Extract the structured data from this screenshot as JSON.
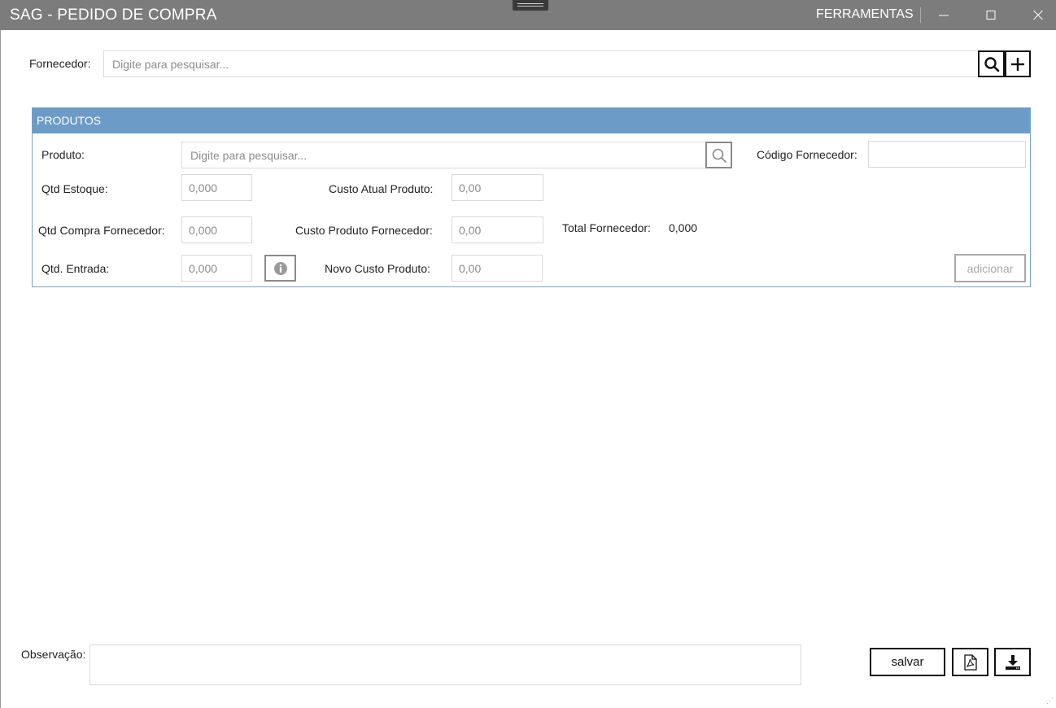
{
  "window": {
    "title": "SAG - PEDIDO DE COMPRA",
    "tools_menu": "FERRAMENTAS"
  },
  "fornecedor": {
    "label": "Fornecedor:",
    "placeholder": "Digite para pesquisar...",
    "search_icon": "search-icon",
    "add_icon": "plus-icon"
  },
  "produtos": {
    "header": "PRODUTOS",
    "produto_label": "Produto:",
    "produto_placeholder": "Digite para pesquisar...",
    "codigo_fornecedor_label": "Código Fornecedor:",
    "codigo_fornecedor_value": "",
    "qtd_estoque_label": "Qtd Estoque:",
    "qtd_estoque_value": "0,000",
    "custo_atual_label": "Custo Atual Produto:",
    "custo_atual_value": "0,00",
    "qtd_compra_label": "Qtd Compra Fornecedor:",
    "qtd_compra_value": "0,000",
    "custo_fornecedor_label": "Custo Produto Fornecedor:",
    "custo_fornecedor_value": "0,00",
    "total_fornecedor_label": "Total Fornecedor:",
    "total_fornecedor_value": "0,000",
    "qtd_entrada_label": "Qtd. Entrada:",
    "qtd_entrada_value": "0,000",
    "novo_custo_label": "Novo Custo Produto:",
    "novo_custo_value": "0,00",
    "adicionar_label": "adicionar"
  },
  "footer": {
    "observacao_label": "Observação:",
    "observacao_value": "",
    "salvar_label": "salvar",
    "pdf_icon": "pdf-icon",
    "download_icon": "download-icon"
  }
}
